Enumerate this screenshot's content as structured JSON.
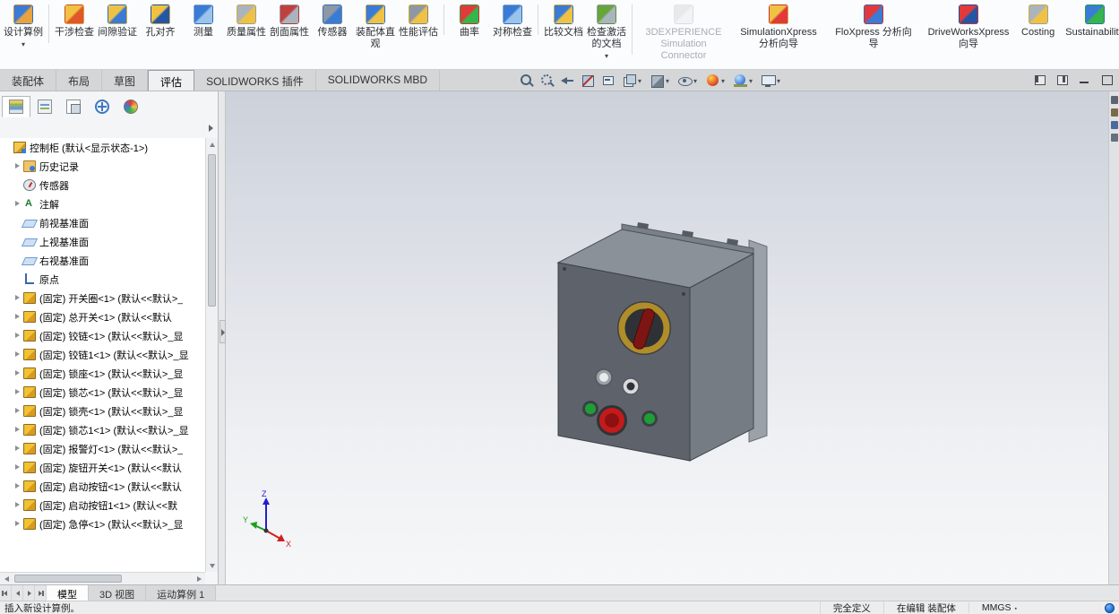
{
  "ribbon": {
    "items": [
      {
        "name": "design-study",
        "label": "设计算例",
        "caret": true,
        "sep": true,
        "colors": [
          "#3a7bd5",
          "#e8a33d"
        ]
      },
      {
        "name": "interference-detection",
        "label": "干涉检查",
        "colors": [
          "#f0c243",
          "#e2562b"
        ]
      },
      {
        "name": "clearance-verification",
        "label": "间隙验证",
        "colors": [
          "#f0c243",
          "#3a7bd5"
        ]
      },
      {
        "name": "hole-alignment",
        "label": "孔对齐",
        "colors": [
          "#f0c243",
          "#2456a8"
        ]
      },
      {
        "name": "measure",
        "label": "测量",
        "colors": [
          "#3a7bd5",
          "#9cc4ea"
        ]
      },
      {
        "name": "mass-properties",
        "label": "质量属性",
        "colors": [
          "#aab4bf",
          "#f0c243"
        ]
      },
      {
        "name": "section-properties",
        "label": "剖面属性",
        "colors": [
          "#c04040",
          "#aab4bf"
        ]
      },
      {
        "name": "sensor",
        "label": "传感器",
        "colors": [
          "#8d98a5",
          "#3a7bd5"
        ]
      },
      {
        "name": "assembly-visualization",
        "label": "装配体直观",
        "colors": [
          "#3a7bd5",
          "#f0c243"
        ]
      },
      {
        "name": "performance-evaluation",
        "label": "性能评估",
        "sep": true,
        "colors": [
          "#8d98a5",
          "#f0c243"
        ]
      },
      {
        "name": "curvature",
        "label": "曲率",
        "colors": [
          "#e23a3a",
          "#35b54a"
        ]
      },
      {
        "name": "symmetry-check",
        "label": "对称检查",
        "sep": true,
        "colors": [
          "#3a7bd5",
          "#9cc4ea"
        ]
      },
      {
        "name": "compare-documents",
        "label": "比较文档",
        "colors": [
          "#3a7bd5",
          "#f0c243"
        ]
      },
      {
        "name": "check-active-document",
        "label": "检查激活的文档",
        "caret": true,
        "sep": true,
        "colors": [
          "#64a53c",
          "#aab4bf"
        ]
      },
      {
        "name": "3dexperience-simulation-connector",
        "label": "3DEXPERIENCE Simulation Connector",
        "disabled": true,
        "wide": true,
        "colors": [
          "#cfd3d7",
          "#e6e9eb"
        ]
      },
      {
        "name": "simulationxpress-wizard",
        "label": "SimulationXpress 分析向导",
        "wide": true,
        "colors": [
          "#f0c243",
          "#e23a3a"
        ]
      },
      {
        "name": "floxpress-wizard",
        "label": "FloXpress 分析向导",
        "wide": true,
        "colors": [
          "#e23a3a",
          "#3a7bd5"
        ]
      },
      {
        "name": "driveworksxpress-wizard",
        "label": "DriveWorksXpress 向导",
        "wide": true,
        "colors": [
          "#e23a3a",
          "#2456a8"
        ]
      },
      {
        "name": "costing",
        "label": "Costing",
        "wide": true,
        "colors": [
          "#aab4bf",
          "#f0c243"
        ]
      },
      {
        "name": "sustainability",
        "label": "Sustainability",
        "wide": true,
        "colors": [
          "#3a7bd5",
          "#35b54a"
        ]
      }
    ]
  },
  "command_tabs": {
    "items": [
      {
        "label": "装配体"
      },
      {
        "label": "布局"
      },
      {
        "label": "草图"
      },
      {
        "label": "评估",
        "active": true
      },
      {
        "label": "SOLIDWORKS 插件"
      },
      {
        "label": "SOLIDWORKS MBD"
      }
    ]
  },
  "view_toolbar": {
    "icons": [
      {
        "name": "zoom-to-fit"
      },
      {
        "name": "zoom-to-area"
      },
      {
        "name": "previous-view"
      },
      {
        "name": "section-view"
      },
      {
        "name": "dynamic-annotation"
      },
      {
        "name": "view-orientation",
        "caret": true
      },
      {
        "name": "display-style",
        "caret": true
      },
      {
        "name": "hide-show-items",
        "caret": true
      },
      {
        "name": "edit-appearance",
        "caret": true
      },
      {
        "name": "apply-scene",
        "caret": true
      },
      {
        "name": "view-settings",
        "caret": true
      }
    ]
  },
  "window_controls": {
    "items": [
      {
        "name": "dock-left"
      },
      {
        "name": "dock-right"
      },
      {
        "name": "minimize-window"
      },
      {
        "name": "restore-window"
      }
    ]
  },
  "feature_panel": {
    "tabs": [
      {
        "name": "featuremanager",
        "active": true
      },
      {
        "name": "propertymanager"
      },
      {
        "name": "configurationmanager"
      },
      {
        "name": "dimxpertmanager"
      },
      {
        "name": "displaymanager"
      }
    ],
    "tree": [
      {
        "icon": "assembly",
        "label": "控制柜 (默认<显示状态-1>)",
        "arrow": false,
        "level": 0
      },
      {
        "icon": "history",
        "label": "历史记录",
        "arrow": true,
        "level": 1
      },
      {
        "icon": "sensor",
        "label": "传感器",
        "arrow": false,
        "level": 1
      },
      {
        "icon": "annotation",
        "label": "注解",
        "arrow": true,
        "level": 1
      },
      {
        "icon": "plane",
        "label": "前视基准面",
        "arrow": false,
        "level": 1
      },
      {
        "icon": "plane",
        "label": "上视基准面",
        "arrow": false,
        "level": 1
      },
      {
        "icon": "plane",
        "label": "右视基准面",
        "arrow": false,
        "level": 1
      },
      {
        "icon": "origin",
        "label": "原点",
        "arrow": false,
        "level": 1
      },
      {
        "icon": "part",
        "label": "(固定) 开关圈<1> (默认<<默认>_",
        "arrow": true,
        "level": 1
      },
      {
        "icon": "part",
        "label": "(固定) 总开关<1> (默认<<默认",
        "arrow": true,
        "level": 1
      },
      {
        "icon": "part",
        "label": "(固定) 铰链<1> (默认<<默认>_显",
        "arrow": true,
        "level": 1
      },
      {
        "icon": "part",
        "label": "(固定) 铰链1<1> (默认<<默认>_显",
        "arrow": true,
        "level": 1
      },
      {
        "icon": "part",
        "label": "(固定) 锁座<1> (默认<<默认>_显",
        "arrow": true,
        "level": 1
      },
      {
        "icon": "part",
        "label": "(固定) 锁芯<1> (默认<<默认>_显",
        "arrow": true,
        "level": 1
      },
      {
        "icon": "part",
        "label": "(固定) 锁壳<1> (默认<<默认>_显",
        "arrow": true,
        "level": 1
      },
      {
        "icon": "part",
        "label": "(固定) 锁芯1<1> (默认<<默认>_显",
        "arrow": true,
        "level": 1
      },
      {
        "icon": "part",
        "label": "(固定) 报警灯<1> (默认<<默认>_",
        "arrow": true,
        "level": 1
      },
      {
        "icon": "part",
        "label": "(固定) 旋钮开关<1> (默认<<默认",
        "arrow": true,
        "level": 1
      },
      {
        "icon": "part",
        "label": "(固定) 启动按钮<1> (默认<<默认",
        "arrow": true,
        "level": 1
      },
      {
        "icon": "part",
        "label": "(固定) 启动按钮1<1> (默认<<默",
        "arrow": true,
        "level": 1
      },
      {
        "icon": "part",
        "label": "(固定) 急停<1> (默认<<默认>_显",
        "arrow": true,
        "level": 1
      }
    ]
  },
  "viewport": {
    "triad": {
      "x": "X",
      "y": "Y",
      "z": "Z",
      "x_color": "#d02020",
      "y_color": "#1e9e1e",
      "z_color": "#2020d0"
    },
    "model_colors": {
      "cabinet_front": "#5e636b",
      "cabinet_side": "#767c84",
      "cabinet_top": "#8b9199",
      "flange": "#9ba1a8",
      "switch_ring": "#b08d28",
      "switch_handle": "#7d1512",
      "estop_red": "#c41a1a",
      "estop_center": "#8e1010",
      "button_green": "#1f9e35"
    }
  },
  "task_pane": {
    "icons": [
      {
        "name": "solidworks-resources"
      },
      {
        "name": "design-library"
      },
      {
        "name": "file-explorer"
      },
      {
        "name": "view-palette"
      }
    ]
  },
  "bottom_bar": {
    "nav": [
      {
        "name": "scroll-first"
      },
      {
        "name": "scroll-prev"
      },
      {
        "name": "scroll-next"
      },
      {
        "name": "scroll-last"
      }
    ],
    "tabs": [
      {
        "label": "模型",
        "active": true
      },
      {
        "label": "3D 视图"
      },
      {
        "label": "运动算例 1"
      }
    ]
  },
  "status_bar": {
    "message": "插入新设计算例。",
    "defined": "完全定义",
    "editing": "在编辑 装配体",
    "units": "MMGS"
  }
}
